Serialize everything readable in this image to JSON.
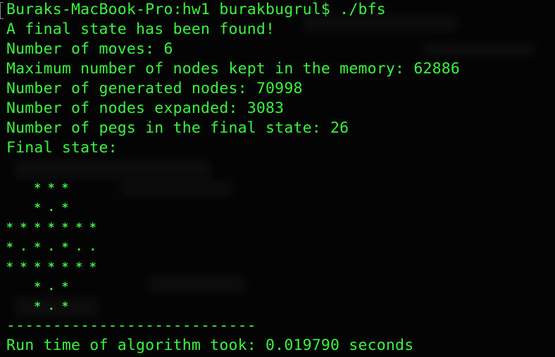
{
  "terminal": {
    "prompt_line": "Buraks-MacBook-Pro:hw1 burakbugrul$ ./bfs",
    "output": [
      "A final state has been found!",
      "Number of moves: 6",
      "Maximum number of nodes kept in the memory: 62886",
      "Number of generated nodes: 70998",
      "Number of nodes expanded: 3083",
      "Number of pegs in the final state: 26",
      "Final state:"
    ],
    "board": [
      "",
      "    * * *",
      "    * . *",
      "* * * * * * *",
      "* . * . * . .",
      "* * * * * * *",
      "    * . *",
      "    * . *"
    ],
    "separator": "---------------------------",
    "runtime": "Run time of algorithm took: 0.019790 seconds"
  },
  "colors": {
    "text": "#39f53c",
    "background": "#040404"
  }
}
